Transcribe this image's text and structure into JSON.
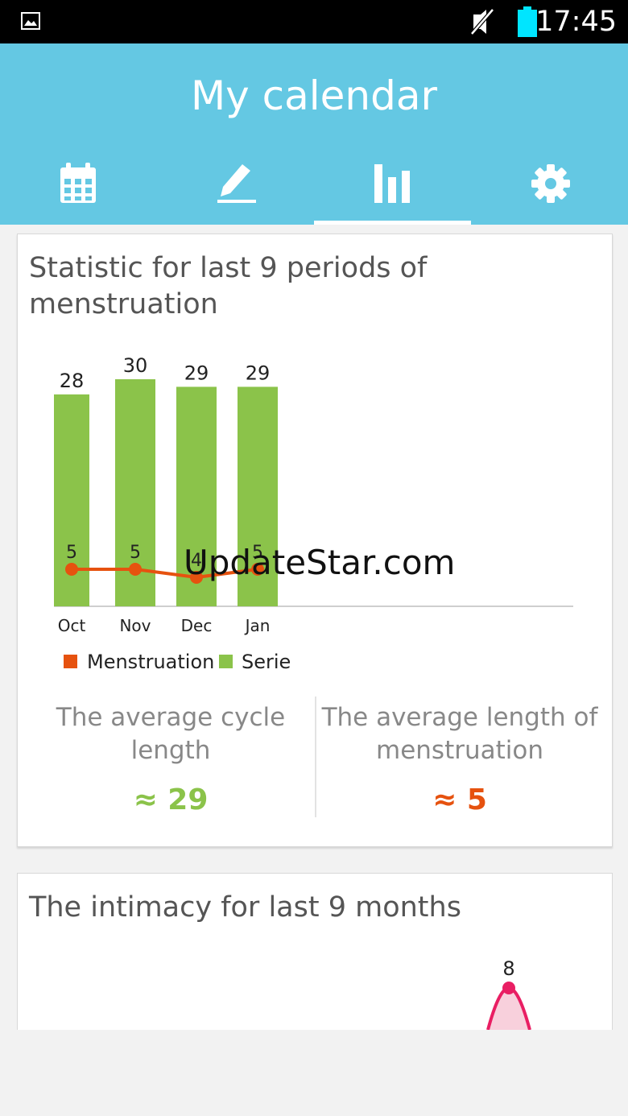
{
  "status_bar": {
    "time": "17:45",
    "icons": [
      "gallery-icon",
      "mute-icon",
      "battery-icon"
    ],
    "battery_color": "#00e5ff"
  },
  "header": {
    "title": "My calendar",
    "background": "#64c8e3",
    "tabs": [
      {
        "icon": "calendar-icon",
        "active": false
      },
      {
        "icon": "pencil-icon",
        "active": false
      },
      {
        "icon": "bar-chart-icon",
        "active": true
      },
      {
        "icon": "gear-icon",
        "active": false
      }
    ]
  },
  "stats_card": {
    "title_line1": "Statistic for last 9 periods of",
    "title_line2": "menstruation",
    "avg_cycle_label_line1": "The average cycle",
    "avg_cycle_label_line2": "length",
    "avg_cycle_value": "≈ 29",
    "avg_length_label_line1": "The average length of",
    "avg_length_label_line2": "menstruation",
    "avg_length_value": "≈ 5"
  },
  "chart_data": [
    {
      "type": "bar",
      "categories": [
        "Oct",
        "Nov",
        "Dec",
        "Jan"
      ],
      "series": [
        {
          "name": "Serie",
          "type": "bar",
          "values": [
            28,
            30,
            29,
            29
          ],
          "color": "#8bc34a"
        },
        {
          "name": "Menstruation",
          "type": "line",
          "values": [
            5,
            5,
            4,
            5
          ],
          "color": "#e6520f"
        }
      ],
      "ylim": [
        0,
        30
      ],
      "legend": "bottom-left",
      "grid": false
    },
    {
      "type": "area",
      "title": "The intimacy for last 9 months",
      "visible_points": [
        8
      ],
      "color": "#e91e63",
      "fill": "#f8d0dc"
    }
  ],
  "intimacy_card": {
    "title": "The intimacy for last 9 months",
    "peak_label": "8"
  },
  "watermark": "UpdateStar.com",
  "colors": {
    "serie": "#8bc34a",
    "menstruation": "#e6520f",
    "intimacy": "#e91e63"
  }
}
